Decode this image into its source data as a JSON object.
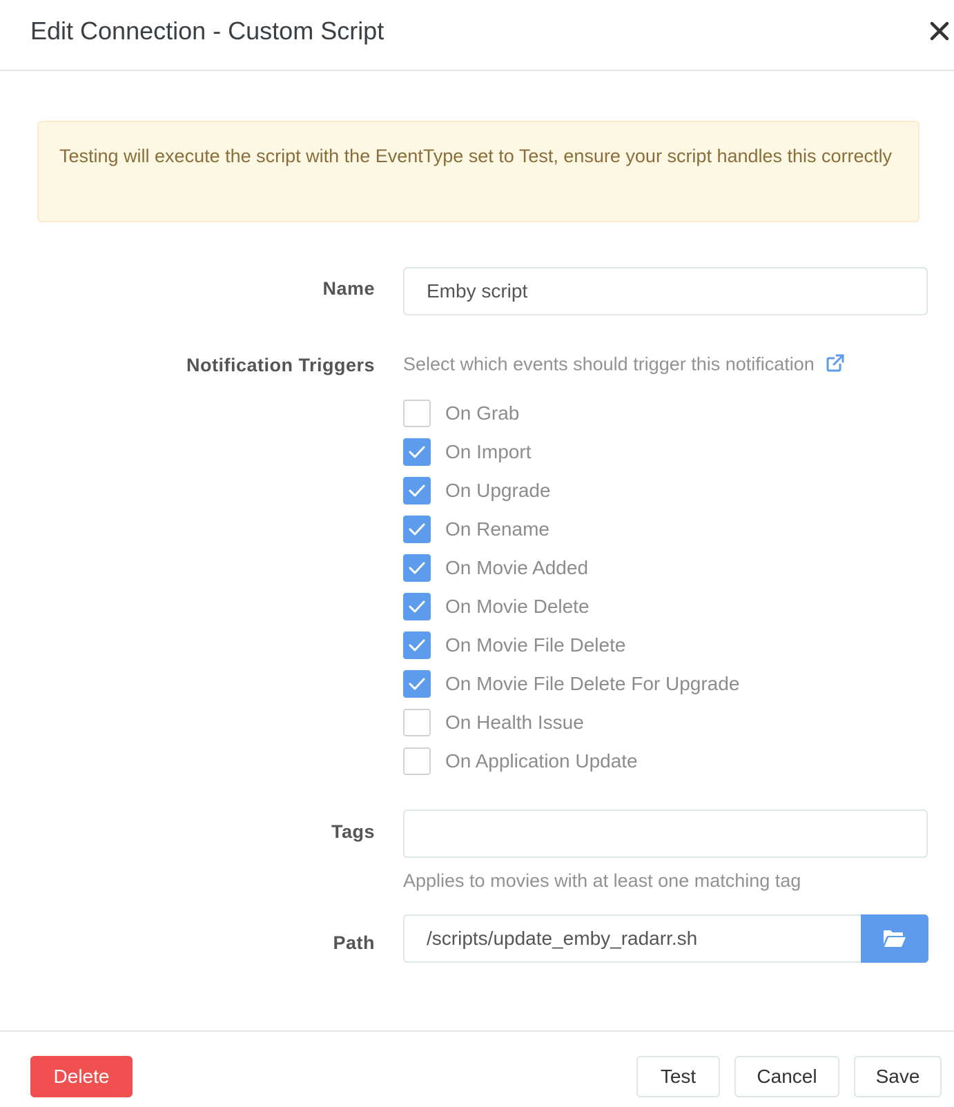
{
  "dialog": {
    "title": "Edit Connection - Custom Script"
  },
  "alert": {
    "text": "Testing will execute the script with the EventType set to Test, ensure your script handles this correctly"
  },
  "form": {
    "name": {
      "label": "Name",
      "value": "Emby script"
    },
    "triggers": {
      "label": "Notification Triggers",
      "help": "Select which events should trigger this notification",
      "items": [
        {
          "label": "On Grab",
          "checked": false
        },
        {
          "label": "On Import",
          "checked": true
        },
        {
          "label": "On Upgrade",
          "checked": true
        },
        {
          "label": "On Rename",
          "checked": true
        },
        {
          "label": "On Movie Added",
          "checked": true
        },
        {
          "label": "On Movie Delete",
          "checked": true
        },
        {
          "label": "On Movie File Delete",
          "checked": true
        },
        {
          "label": "On Movie File Delete For Upgrade",
          "checked": true
        },
        {
          "label": "On Health Issue",
          "checked": false
        },
        {
          "label": "On Application Update",
          "checked": false
        }
      ]
    },
    "tags": {
      "label": "Tags",
      "value": "",
      "help": "Applies to movies with at least one matching tag"
    },
    "path": {
      "label": "Path",
      "value": "/scripts/update_emby_radarr.sh"
    }
  },
  "footer": {
    "delete_label": "Delete",
    "test_label": "Test",
    "cancel_label": "Cancel",
    "save_label": "Save"
  },
  "icons": {
    "close": "close-icon",
    "external_link": "external-link-icon",
    "folder": "folder-open-icon",
    "check": "checkmark-icon"
  },
  "colors": {
    "accent": "#5d9cec",
    "danger": "#f05050",
    "alert_bg": "#fcf8e3",
    "alert_text": "#8a6d3b"
  }
}
